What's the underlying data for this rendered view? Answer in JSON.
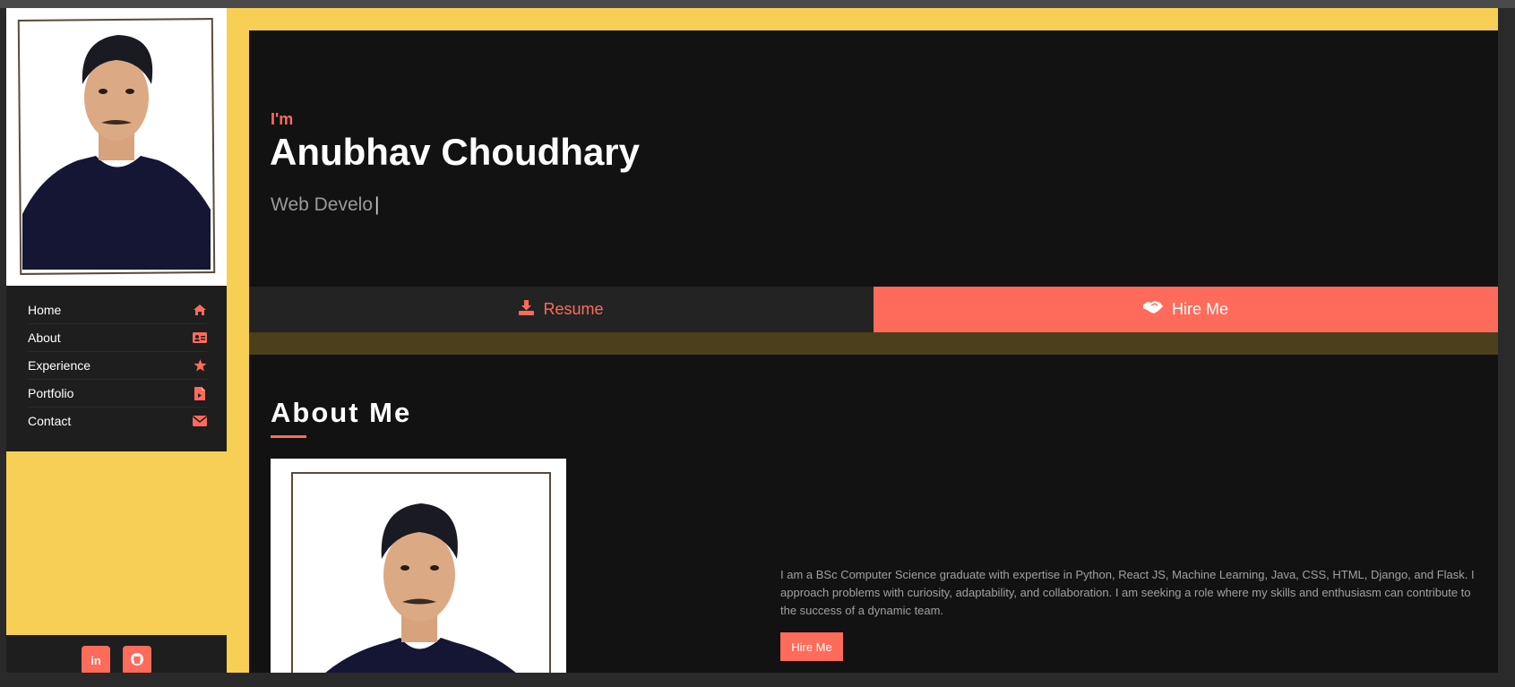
{
  "sidebar": {
    "nav": [
      {
        "label": "Home",
        "icon": "home-icon"
      },
      {
        "label": "About",
        "icon": "id-card-icon"
      },
      {
        "label": "Experience",
        "icon": "star-icon"
      },
      {
        "label": "Portfolio",
        "icon": "file-icon"
      },
      {
        "label": "Contact",
        "icon": "envelope-icon"
      }
    ],
    "social": [
      {
        "label": "in",
        "icon": "linkedin-icon"
      },
      {
        "label": "",
        "icon": "github-icon"
      }
    ]
  },
  "hero": {
    "greeting": "I'm",
    "name": "Anubhav Choudhary",
    "role": "Web Develo",
    "caret": "|"
  },
  "actions": {
    "resume_label": "Resume",
    "hire_label": "Hire Me"
  },
  "about": {
    "title": "About Me",
    "text": "I am a BSc Computer Science graduate with expertise in Python, React JS, Machine Learning, Java, CSS, HTML, Django, and Flask. I approach problems with curiosity, adaptability, and collaboration. I am seeking a role where my skills and enthusiasm can contribute to the success of a dynamic team.",
    "hire_label": "Hire Me"
  },
  "colors": {
    "accent": "#ff6b5b",
    "frame": "#f7cf55",
    "panel": "#121212",
    "sidebar": "#1e1e1e"
  }
}
